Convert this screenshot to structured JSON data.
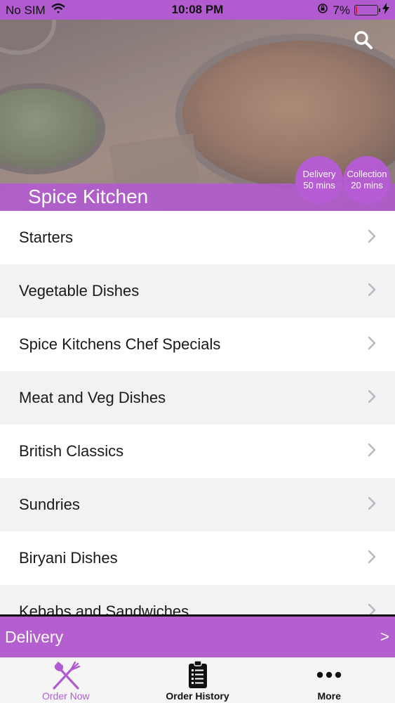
{
  "status_bar": {
    "carrier": "No SIM",
    "time": "10:08 PM",
    "battery": "7%",
    "battery_level": 0.07
  },
  "header": {
    "restaurant_name": "Spice Kitchen",
    "delivery": {
      "label": "Delivery",
      "time": "50 mins"
    },
    "collection": {
      "label": "Collection",
      "time": "20 mins"
    }
  },
  "menu": {
    "categories": [
      {
        "label": "Starters"
      },
      {
        "label": "Vegetable Dishes"
      },
      {
        "label": "Spice Kitchens Chef Specials"
      },
      {
        "label": "Meat and Veg Dishes"
      },
      {
        "label": "British Classics"
      },
      {
        "label": "Sundries"
      },
      {
        "label": "Biryani Dishes"
      },
      {
        "label": "Kebabs and Sandwiches"
      }
    ]
  },
  "order_bar": {
    "mode": "Delivery",
    "arrow": ">"
  },
  "tabs": [
    {
      "label": "Order Now",
      "icon": "fork-knife-icon",
      "active": true
    },
    {
      "label": "Order History",
      "icon": "clipboard-list-icon",
      "active": false
    },
    {
      "label": "More",
      "icon": "more-dots-icon",
      "active": false
    }
  ],
  "colors": {
    "accent": "#b25bd0",
    "battery_low": "#e02020"
  }
}
